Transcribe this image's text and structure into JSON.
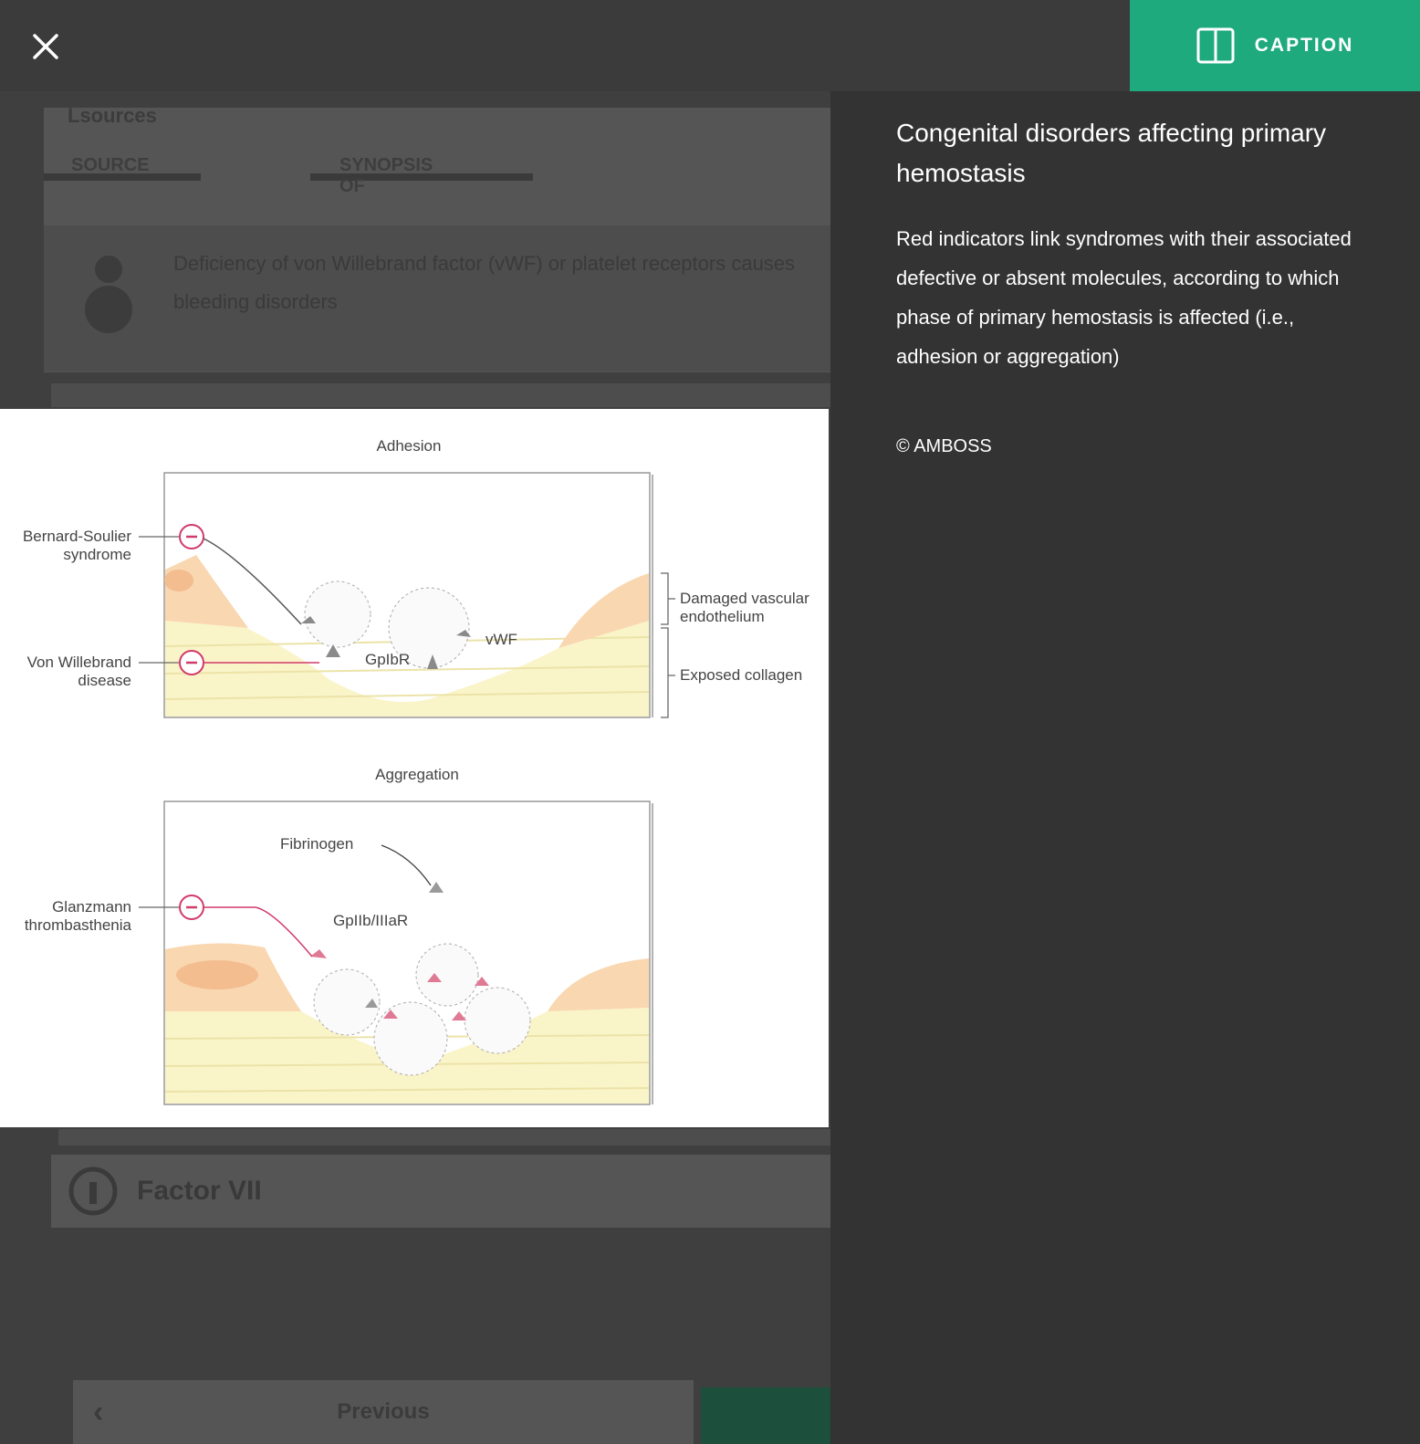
{
  "toolbar": {
    "close_icon": "close-icon",
    "caption_icon": "panel-split-icon",
    "caption_label": "CAPTION",
    "accent_color": "#1faa7e"
  },
  "background_article": {
    "card_title": "Lsources",
    "tabs": [
      "SOURCE",
      "",
      "SYNOPSIS OF"
    ],
    "text": "Deficiency of von Willebrand factor (vWF) or platelet receptors causes bleeding disorders",
    "factor_title": "Factor VII",
    "nav_label": "Previous"
  },
  "figure": {
    "panels": [
      {
        "title": "Adhesion",
        "left_labels": [
          {
            "line1": "Bernard-Soulier",
            "line2": "syndrome"
          },
          {
            "line1": "Von Willebrand",
            "line2": "disease"
          }
        ],
        "right_labels": [
          {
            "line1": "Damaged vascular",
            "line2": "endothelium"
          },
          {
            "line1": "Exposed collagen",
            "line2": ""
          }
        ],
        "inner_labels": [
          "GpIbR",
          "vWF"
        ]
      },
      {
        "title": "Aggregation",
        "left_labels": [
          {
            "line1": "Glanzmann",
            "line2": "thrombasthenia"
          }
        ],
        "inner_labels": [
          "Fibrinogen",
          "GpIIb/IIIaR"
        ]
      }
    ]
  },
  "caption": {
    "title": "Congenital disorders affecting primary hemostasis",
    "body": "Red indicators link syndromes with their associated defective or absent molecules, according to which phase of primary hemostasis is affected (i.e., adhesion or aggregation)",
    "copyright": "© AMBOSS"
  }
}
